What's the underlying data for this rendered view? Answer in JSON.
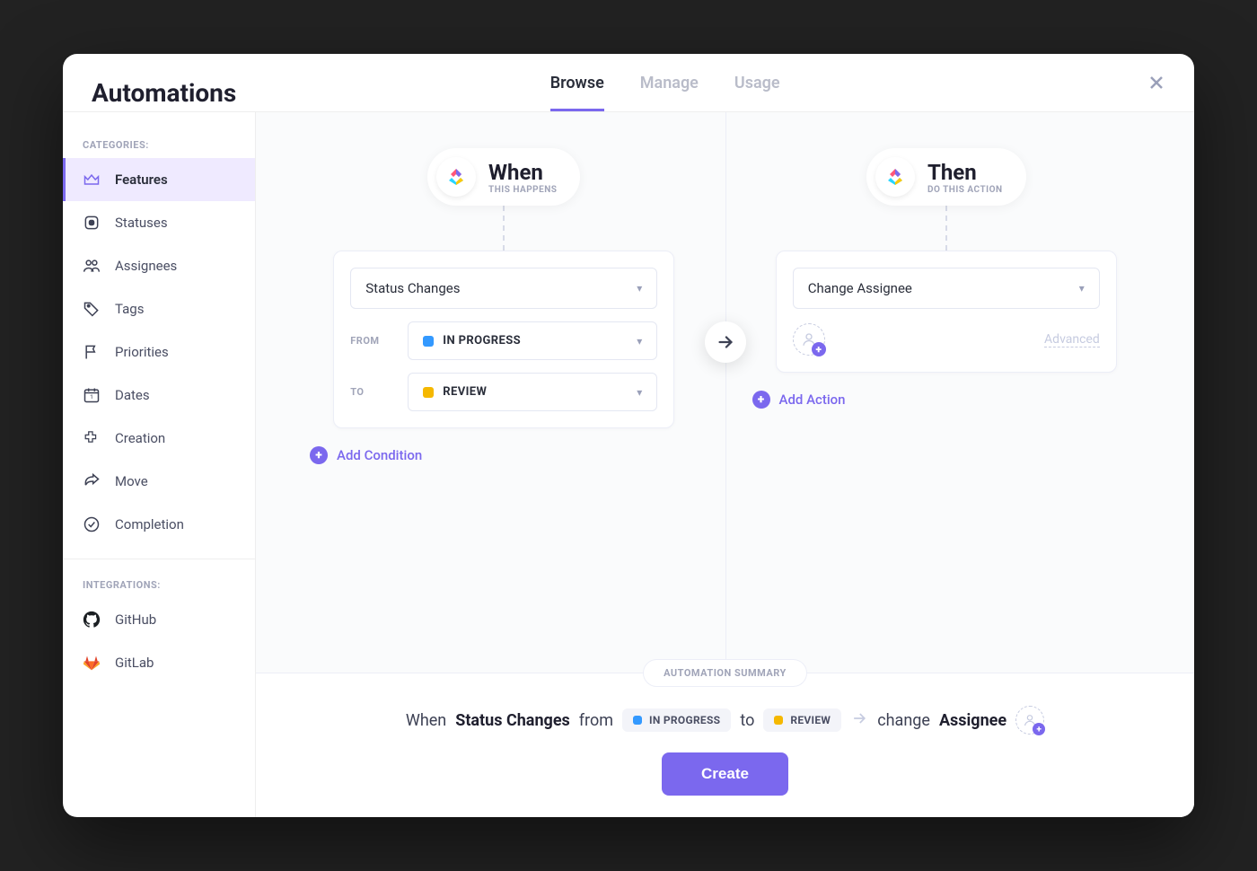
{
  "header": {
    "title": "Automations",
    "tabs": [
      {
        "label": "Browse",
        "active": true
      },
      {
        "label": "Manage",
        "active": false
      },
      {
        "label": "Usage",
        "active": false
      }
    ]
  },
  "sidebar": {
    "categories_label": "CATEGORIES:",
    "integrations_label": "INTEGRATIONS:",
    "categories": [
      {
        "label": "Features",
        "icon": "crown",
        "active": true
      },
      {
        "label": "Statuses",
        "icon": "status",
        "active": false
      },
      {
        "label": "Assignees",
        "icon": "assignees",
        "active": false
      },
      {
        "label": "Tags",
        "icon": "tag",
        "active": false
      },
      {
        "label": "Priorities",
        "icon": "flag",
        "active": false
      },
      {
        "label": "Dates",
        "icon": "calendar",
        "active": false
      },
      {
        "label": "Creation",
        "icon": "plus",
        "active": false
      },
      {
        "label": "Move",
        "icon": "share",
        "active": false
      },
      {
        "label": "Completion",
        "icon": "check",
        "active": false
      }
    ],
    "integrations": [
      {
        "label": "GitHub",
        "icon": "github"
      },
      {
        "label": "GitLab",
        "icon": "gitlab"
      }
    ]
  },
  "builder": {
    "when": {
      "title": "When",
      "subtitle": "THIS HAPPENS",
      "trigger": "Status Changes",
      "from_label": "FROM",
      "to_label": "TO",
      "from_status": {
        "label": "IN PROGRESS",
        "color": "#3399ff"
      },
      "to_status": {
        "label": "REVIEW",
        "color": "#f5b800"
      },
      "add_condition": "Add Condition"
    },
    "then": {
      "title": "Then",
      "subtitle": "DO THIS ACTION",
      "action": "Change Assignee",
      "advanced": "Advanced",
      "add_action": "Add Action"
    }
  },
  "summary": {
    "label": "AUTOMATION SUMMARY",
    "when_word": "When",
    "trigger_bold": "Status Changes",
    "from_word": "from",
    "from_status": {
      "label": "IN PROGRESS",
      "color": "#3399ff"
    },
    "to_word": "to",
    "to_status": {
      "label": "REVIEW",
      "color": "#f5b800"
    },
    "change_word": "change",
    "action_bold": "Assignee",
    "create_button": "Create"
  },
  "colors": {
    "accent": "#7b68ee"
  }
}
